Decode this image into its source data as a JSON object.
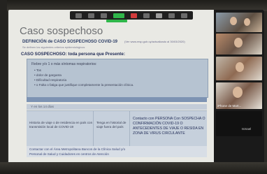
{
  "slide": {
    "title": "Caso sospechoso",
    "definition": "DEFINICIÓN de CASO SOSPECHOSO COVID-19",
    "url": "(Ver www.msp.gub.uy/actualizado al 30/03/2020)",
    "sub_url": "Se definen los siguientes criterios epidemiológicos",
    "suspect_heading": "CASO SOSPECHOSO: toda persona que Presente:",
    "criteria_intro": "Fiebre y/o 1 o más síntomas respiratorios:",
    "criteria": [
      "Tos",
      "dolor de garganta",
      "Dificultad respiratoria",
      "o Falta o fatiga que justifique completamente la presentación clínica."
    ],
    "band_label": "Y en los 14 días",
    "table": {
      "col1": "Historia de viaje o de residencia en país con transmisión local de COVID-19",
      "col2": "Tenga en historial de viaje fuera del país",
      "col3": "Contacto con PERSONA Con SOSPECHA O CONFIRMACIÓN COVID-19 O ANTECEDENTES DE VIAJE O RESIDA EN ZONA DE VIRUS CIRCULANTE"
    },
    "bottom_band": [
      "Contactar con el Área Metropolitana Bancos de la Clínica Salud y/o",
      "Personal de Salud y Cuidadores en centros de Atención"
    ]
  },
  "participants": [
    {
      "name": ""
    },
    {
      "name": ""
    },
    {
      "name": ""
    },
    {
      "name": "iPhone de Mart..."
    },
    {
      "name": "Ismael"
    }
  ]
}
